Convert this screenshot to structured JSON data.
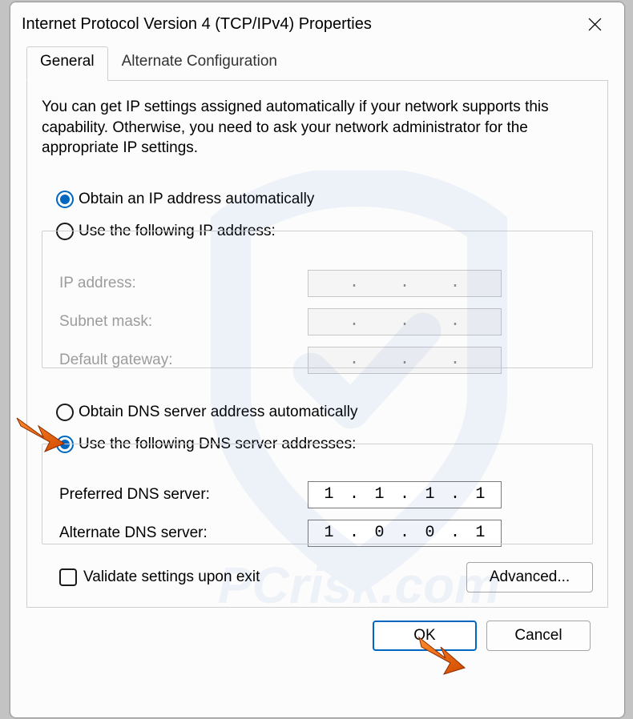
{
  "window": {
    "title": "Internet Protocol Version 4 (TCP/IPv4) Properties"
  },
  "tabs": {
    "general": "General",
    "alternate": "Alternate Configuration"
  },
  "description": "You can get IP settings assigned automatically if your network supports this capability. Otherwise, you need to ask your network administrator for the appropriate IP settings.",
  "ip_section": {
    "auto_label": "Obtain an IP address automatically",
    "manual_label": "Use the following IP address:",
    "selected": "auto",
    "fields": {
      "ip_label": "IP address:",
      "subnet_label": "Subnet mask:",
      "gateway_label": "Default gateway:",
      "ip_value": [
        "",
        "",
        "",
        ""
      ],
      "subnet_value": [
        "",
        "",
        "",
        ""
      ],
      "gateway_value": [
        "",
        "",
        "",
        ""
      ]
    }
  },
  "dns_section": {
    "auto_label": "Obtain DNS server address automatically",
    "manual_label": "Use the following DNS server addresses:",
    "selected": "manual",
    "fields": {
      "preferred_label": "Preferred DNS server:",
      "alternate_label": "Alternate DNS server:",
      "preferred_value": [
        "1",
        "1",
        "1",
        "1"
      ],
      "alternate_value": [
        "1",
        "0",
        "0",
        "1"
      ]
    }
  },
  "validate_label": "Validate settings upon exit",
  "validate_checked": false,
  "buttons": {
    "advanced": "Advanced...",
    "ok": "OK",
    "cancel": "Cancel"
  },
  "watermark_text": "PCrisk.com"
}
